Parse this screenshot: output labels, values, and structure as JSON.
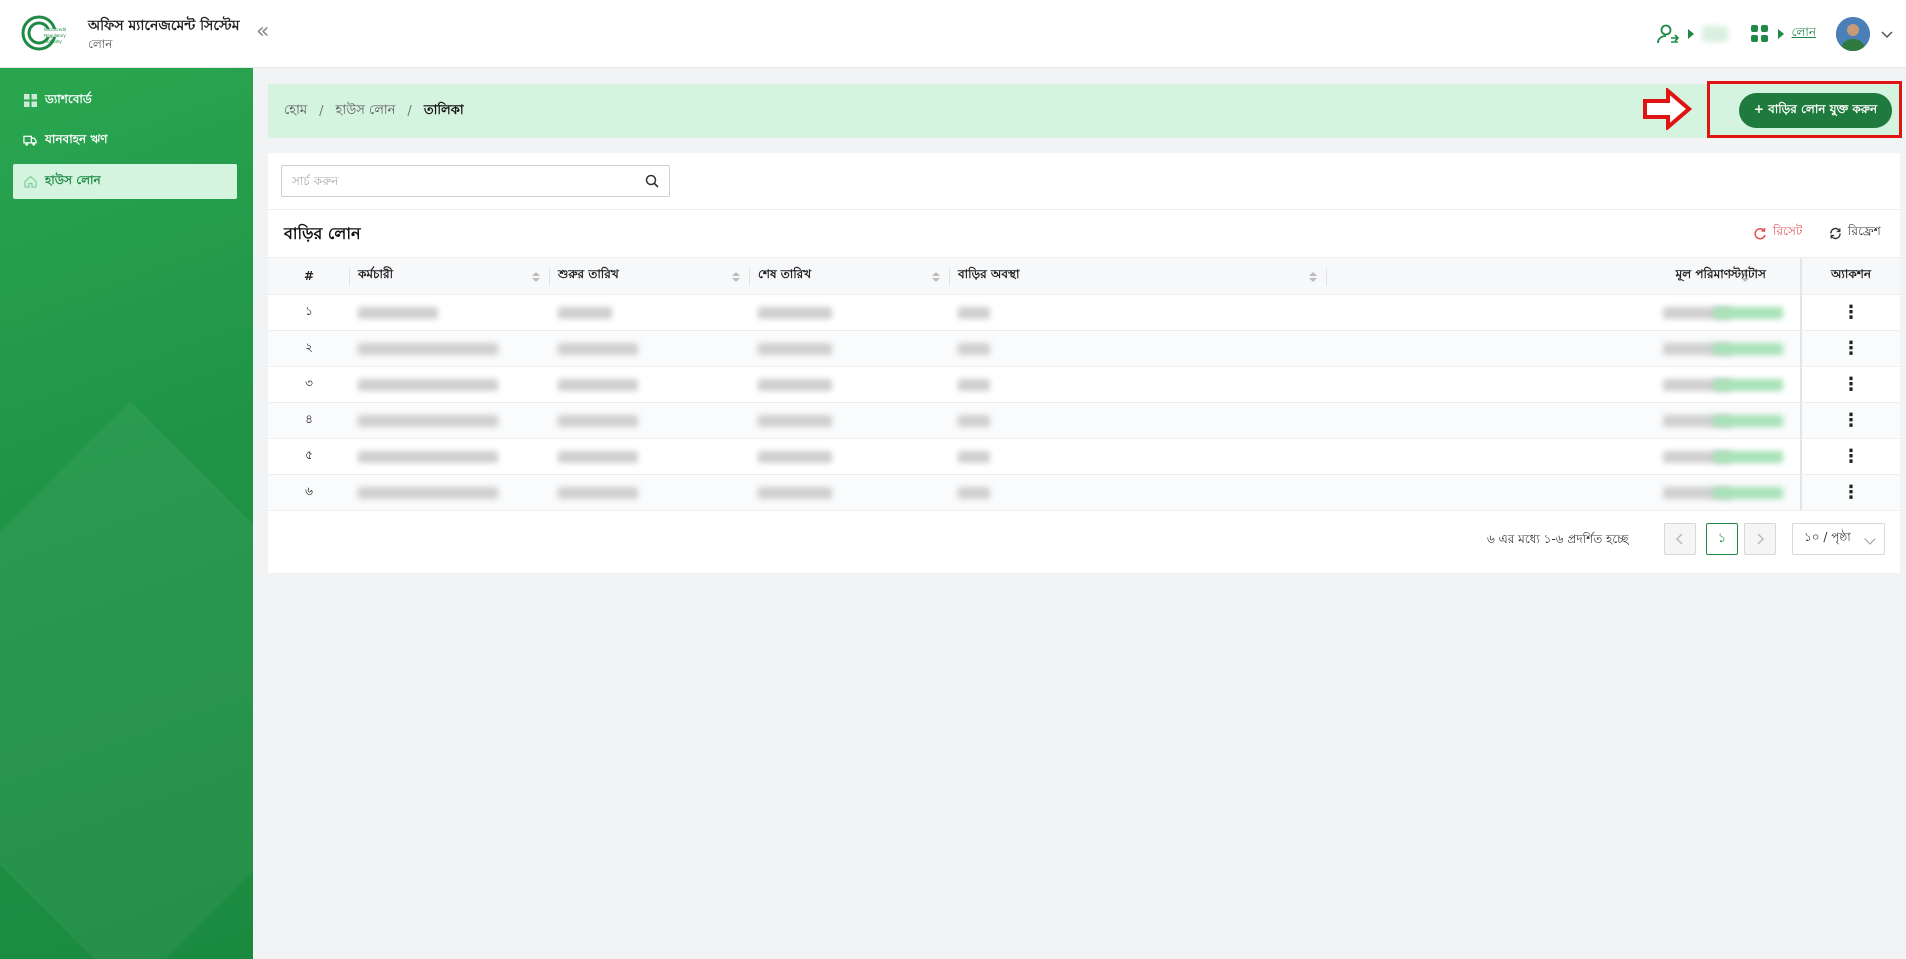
{
  "header": {
    "app_title": "অফিস ম্যানেজমেন্ট সিস্টেম",
    "app_subtitle": "লোন",
    "collapse_icon": "«",
    "nav_link": "লোন"
  },
  "sidebar": {
    "items": [
      {
        "label": "ড্যাশবোর্ড",
        "icon": "dashboard-icon"
      },
      {
        "label": "যানবাহন ঋণ",
        "icon": "vehicle-icon"
      },
      {
        "label": "হাউস লোন",
        "icon": "home-icon",
        "active": true
      }
    ]
  },
  "breadcrumb": {
    "home": "হোম",
    "section": "হাউস লোন",
    "current": "তালিকা",
    "separator": "/"
  },
  "actions": {
    "add_button": "+ বাড়ির লোন যুক্ত করুন"
  },
  "search": {
    "placeholder": "সার্চ করুন"
  },
  "table": {
    "title": "বাড়ির লোন",
    "reset_label": "রিসেট",
    "refresh_label": "রিফ্রেশ",
    "columns": [
      "#",
      "কর্মচারী",
      "শুরুর তারিখ",
      "শেষ তারিখ",
      "বাড়ির অবস্থা",
      "মূল পরিমাণ",
      "স্ট্যাটাস",
      "অ্যাকশন"
    ],
    "row_numbers": [
      "১",
      "২",
      "৩",
      "৪",
      "৫",
      "৬"
    ]
  },
  "pagination": {
    "info": "৬ এর মধ্যে ১-৬ প্রদর্শিত হচ্ছে",
    "current_page": "১",
    "page_size": "১০ / পৃষ্ঠা"
  },
  "colors": {
    "brand_green": "#1e8a45",
    "button_green": "#1e7a3d",
    "breadcrumb_bg": "#d5f4df",
    "annotation_red": "#e11414",
    "reset_red": "#e35050"
  }
}
